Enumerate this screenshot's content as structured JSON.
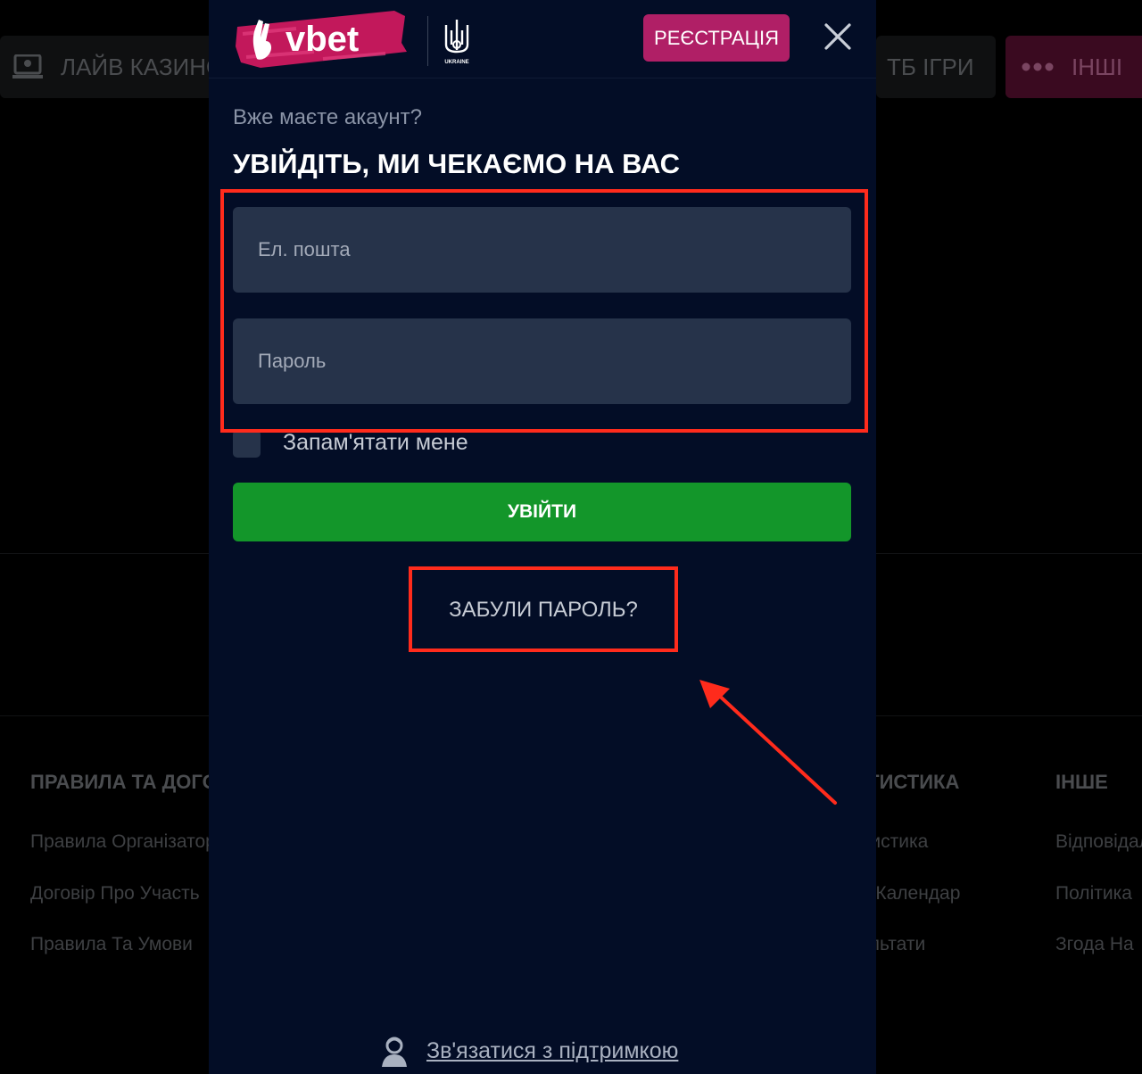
{
  "background": {
    "nav": {
      "live_casino": "ЛАЙВ КАЗИНО",
      "tv_games": "ТБ ІГРИ",
      "other": "ІНШІ"
    },
    "footer": {
      "columns": [
        {
          "title": "ПРАВИЛА ТА ДОГОВОРИ",
          "links": [
            "Правила Організатора",
            "Договір Про Участь",
            "Правила Та Умови"
          ]
        },
        {
          "title": "СТАТИСТИКА",
          "links": [
            "Статистика",
            "LIVE Календар",
            "Результати"
          ]
        },
        {
          "title": "ІНШЕ",
          "links": [
            "Відповідальна гра",
            "Політика",
            "Згода На"
          ]
        }
      ]
    }
  },
  "modal": {
    "logo_text": "vbet",
    "partner_text": "UKRAINE",
    "register_label": "РЕЄСТРАЦІЯ",
    "subtitle": "Вже маєте акаунт?",
    "heading": "УВІЙДІТЬ, МИ ЧЕКАЄМО НА ВАС",
    "email_placeholder": "Ел. пошта",
    "password_placeholder": "Пароль",
    "remember_label": "Запам'ятати мене",
    "login_label": "УВІЙТИ",
    "forgot_label": "ЗАБУЛИ ПАРОЛЬ?",
    "support_label": "Зв'язатися з підтримкою"
  },
  "colors": {
    "modal_bg": "#030d26",
    "field_bg": "#26334a",
    "register": "#b01f66",
    "login": "#13962a",
    "annotation": "#ff2b1c"
  }
}
